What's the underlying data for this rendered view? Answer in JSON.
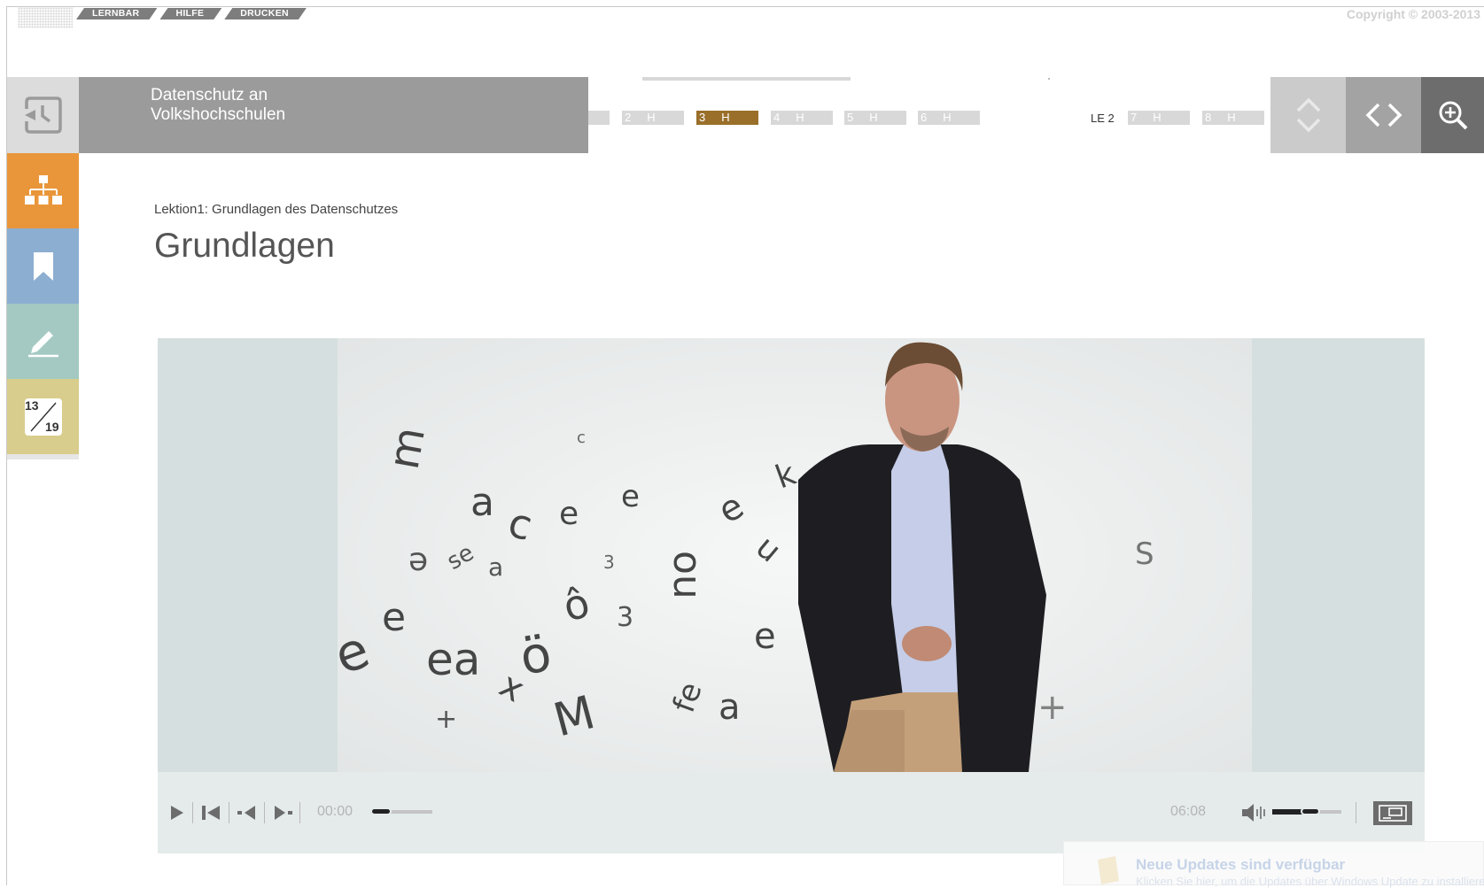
{
  "top_menu": {
    "items": [
      "LERNBAR",
      "HILFE",
      "DRUCKEN"
    ]
  },
  "copyright": "Copyright © 2003-2013",
  "header": {
    "course_title_line1": "Datenschutz an",
    "course_title_line2": "Volkshochschulen",
    "pages_group1": [
      {
        "num": "2",
        "suffix": "H"
      },
      {
        "num": "3",
        "suffix": "H",
        "active": true
      },
      {
        "num": "4",
        "suffix": "H"
      },
      {
        "num": "5",
        "suffix": "H"
      },
      {
        "num": "6",
        "suffix": "H"
      }
    ],
    "le_label": "LE 2",
    "pages_group2": [
      {
        "num": "7",
        "suffix": "H"
      },
      {
        "num": "8",
        "suffix": "H"
      }
    ]
  },
  "sidebar": {
    "items": [
      {
        "name": "sitemap",
        "color": "#e9963a"
      },
      {
        "name": "bookmark",
        "color": "#8caed1"
      },
      {
        "name": "notes",
        "color": "#a3c9c2"
      },
      {
        "name": "page-counter",
        "color": "#d8cd8c",
        "current": "13",
        "total": "19"
      }
    ]
  },
  "content": {
    "breadcrumb": "Lektion1: Grundlagen des Datenschutzes",
    "title": "Grundlagen"
  },
  "video": {
    "time_current": "00:00",
    "time_total": "06:08",
    "progress": 0.0,
    "volume": 0.55
  },
  "toast": {
    "title": "Neue Updates sind verfügbar",
    "text": "Klicken Sie hier, um die Updates über Windows Update zu installieren."
  },
  "colors": {
    "active_page": "#9a6f2a",
    "header_gray": "#9b9b9b"
  }
}
